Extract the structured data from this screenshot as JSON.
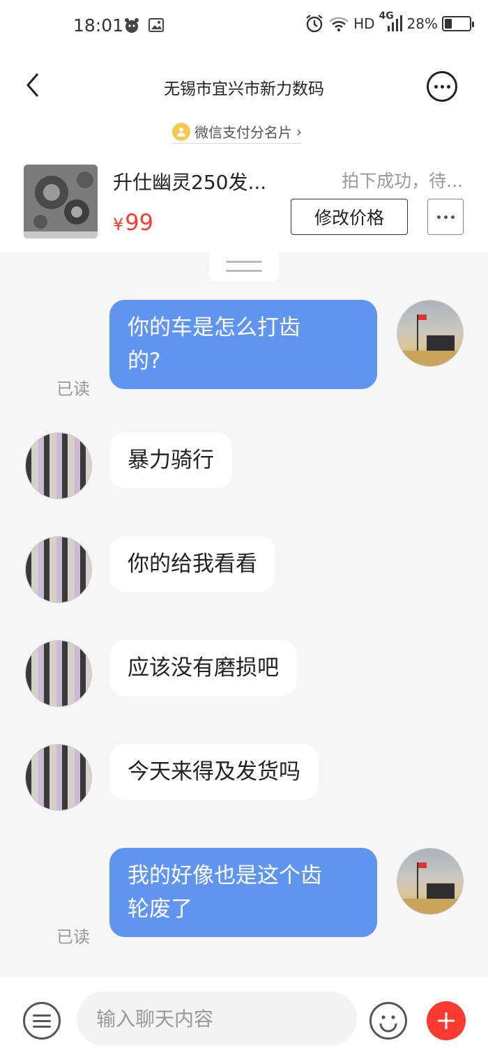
{
  "status_bar": {
    "time": "18:01",
    "network_type": "4G",
    "hd_label": "HD",
    "battery_percent": "28%",
    "battery_level": 0.28
  },
  "header": {
    "title": "无锡市宜兴市新力数码"
  },
  "pay_card": {
    "label": "微信支付分名片",
    "chevron": "›"
  },
  "product": {
    "name": "升仕幽灵250发...",
    "currency": "¥",
    "price": "99",
    "status": "拍下成功，待...",
    "edit_price_label": "修改价格"
  },
  "messages": [
    {
      "sender": "me",
      "line1": "你的车是怎么打齿",
      "line2": "的?",
      "read_label": "已读"
    },
    {
      "sender": "other",
      "text": "暴力骑行"
    },
    {
      "sender": "other",
      "text": "你的给我看看"
    },
    {
      "sender": "other",
      "text": "应该没有磨损吧"
    },
    {
      "sender": "other",
      "text": "今天来得及发货吗"
    },
    {
      "sender": "me",
      "line1": "我的好像也是这个齿",
      "line2": "轮废了",
      "read_label": "已读"
    }
  ],
  "input_bar": {
    "placeholder": "输入聊天内容"
  },
  "colors": {
    "my_bubble": "#5f95f0",
    "price": "#ff3b30",
    "plus_button": "#ff3b30"
  },
  "icons": [
    "back-arrow-icon",
    "more-icon",
    "pay-score-icon",
    "menu-icon",
    "emoji-icon",
    "plus-icon",
    "alarm-icon",
    "wifi-icon",
    "signal-icon",
    "battery-icon",
    "gallery-icon",
    "pet-icon"
  ]
}
